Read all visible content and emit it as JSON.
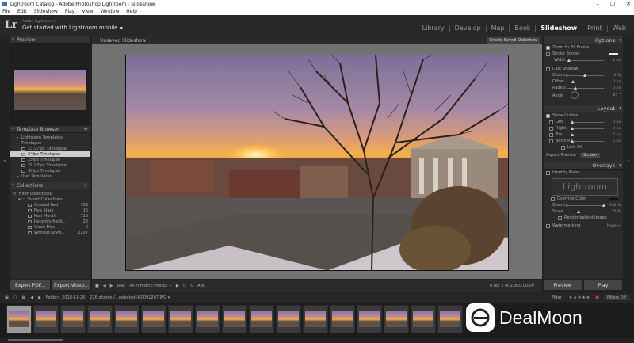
{
  "window": {
    "title": "Lightroom Catalog - Adobe Photoshop Lightroom - Slideshow"
  },
  "menu": [
    "File",
    "Edit",
    "Slideshow",
    "Play",
    "View",
    "Window",
    "Help"
  ],
  "header": {
    "logo": "Lr",
    "product": "Adobe Lightroom 6",
    "mobile_msg": "Get started with Lightroom mobile",
    "modules": [
      "Library",
      "Develop",
      "Map",
      "Book",
      "Slideshow",
      "Print",
      "Web"
    ],
    "active_module": "Slideshow"
  },
  "left": {
    "preview_label": "Preview",
    "template_browser_label": "Template Browser",
    "templates": [
      {
        "label": "Lightroom Templates",
        "indent": 1,
        "selected": false
      },
      {
        "label": "Timelapse",
        "indent": 1,
        "selected": false
      },
      {
        "label": "23.97fps Timelapse",
        "indent": 2,
        "selected": false
      },
      {
        "label": "24fps Timelapse",
        "indent": 2,
        "selected": true
      },
      {
        "label": "25fps Timelapse",
        "indent": 2,
        "selected": false
      },
      {
        "label": "29.97fps Timelapse",
        "indent": 2,
        "selected": false
      },
      {
        "label": "30fps Timelapse",
        "indent": 2,
        "selected": false
      },
      {
        "label": "User Templates",
        "indent": 1,
        "selected": false
      }
    ],
    "collections_label": "Collections",
    "filter_collections": "Filter Collections",
    "smart_collections_label": "Smart Collections",
    "smart_collections": [
      {
        "label": "Colored Red",
        "count": "163"
      },
      {
        "label": "Five Stars",
        "count": "16"
      },
      {
        "label": "Past Month",
        "count": "710"
      },
      {
        "label": "Recently Modi...",
        "count": "23"
      },
      {
        "label": "Video Files",
        "count": "0"
      },
      {
        "label": "Without Keyw...",
        "count": "2207"
      }
    ],
    "export_pdf": "Export PDF...",
    "export_video": "Export Video..."
  },
  "center": {
    "title": "Unsaved Slideshow",
    "create_btn": "Create Saved Slideshow",
    "toolbar": {
      "use_label": "Use:",
      "use_value": "All Filmstrip Photos",
      "abc": "ABC",
      "slide_info": "0 sec 1 of 226 0:00:09"
    }
  },
  "right": {
    "options_label": "Options",
    "zoom_to_fill": "Zoom to Fill Frame",
    "stroke_border": "Stroke Border",
    "width_label": "Width",
    "width_val": "1 px",
    "cast_shadow": "Cast Shadow",
    "opacity_label": "Opacity",
    "opacity_val": "0 %",
    "offset_label": "Offset",
    "offset_val": "0 px",
    "radius_label": "Radius",
    "radius_val": "0 px",
    "angle_label": "Angle",
    "angle_val": "-45 °",
    "layout_label": "Layout",
    "show_guides": "Show Guides",
    "left_label": "Left",
    "left_val": "0 px",
    "right_label": "Right",
    "right_val": "0 px",
    "top_label": "Top",
    "top_val": "0 px",
    "bottom_label": "Bottom",
    "bottom_val": "0 px",
    "link_all": "Link All",
    "aspect_label": "Aspect Preview",
    "aspect_value": "Screen",
    "overlays_label": "Overlays",
    "identity_plate": "Identity Plate",
    "plate_text": "Lightroom",
    "override_color": "Override Color",
    "op_label": "Opacity",
    "op_val": "100 %",
    "scale_label": "Scale",
    "scale_val": "25 %",
    "render_behind": "Render behind image",
    "watermarking": "Watermarking :",
    "watermark_val": "None ÷",
    "preview_btn": "Preview",
    "play_btn": "Play"
  },
  "filmstrip": {
    "folder": "Folder : 2018-11-26",
    "count": "226 photos /1 selected /G0092207.JPG ▾",
    "filter_label": "Filter :",
    "filter_value": "Filters Off",
    "thumb_count": 17
  },
  "watermark_brand": "DealMoon"
}
